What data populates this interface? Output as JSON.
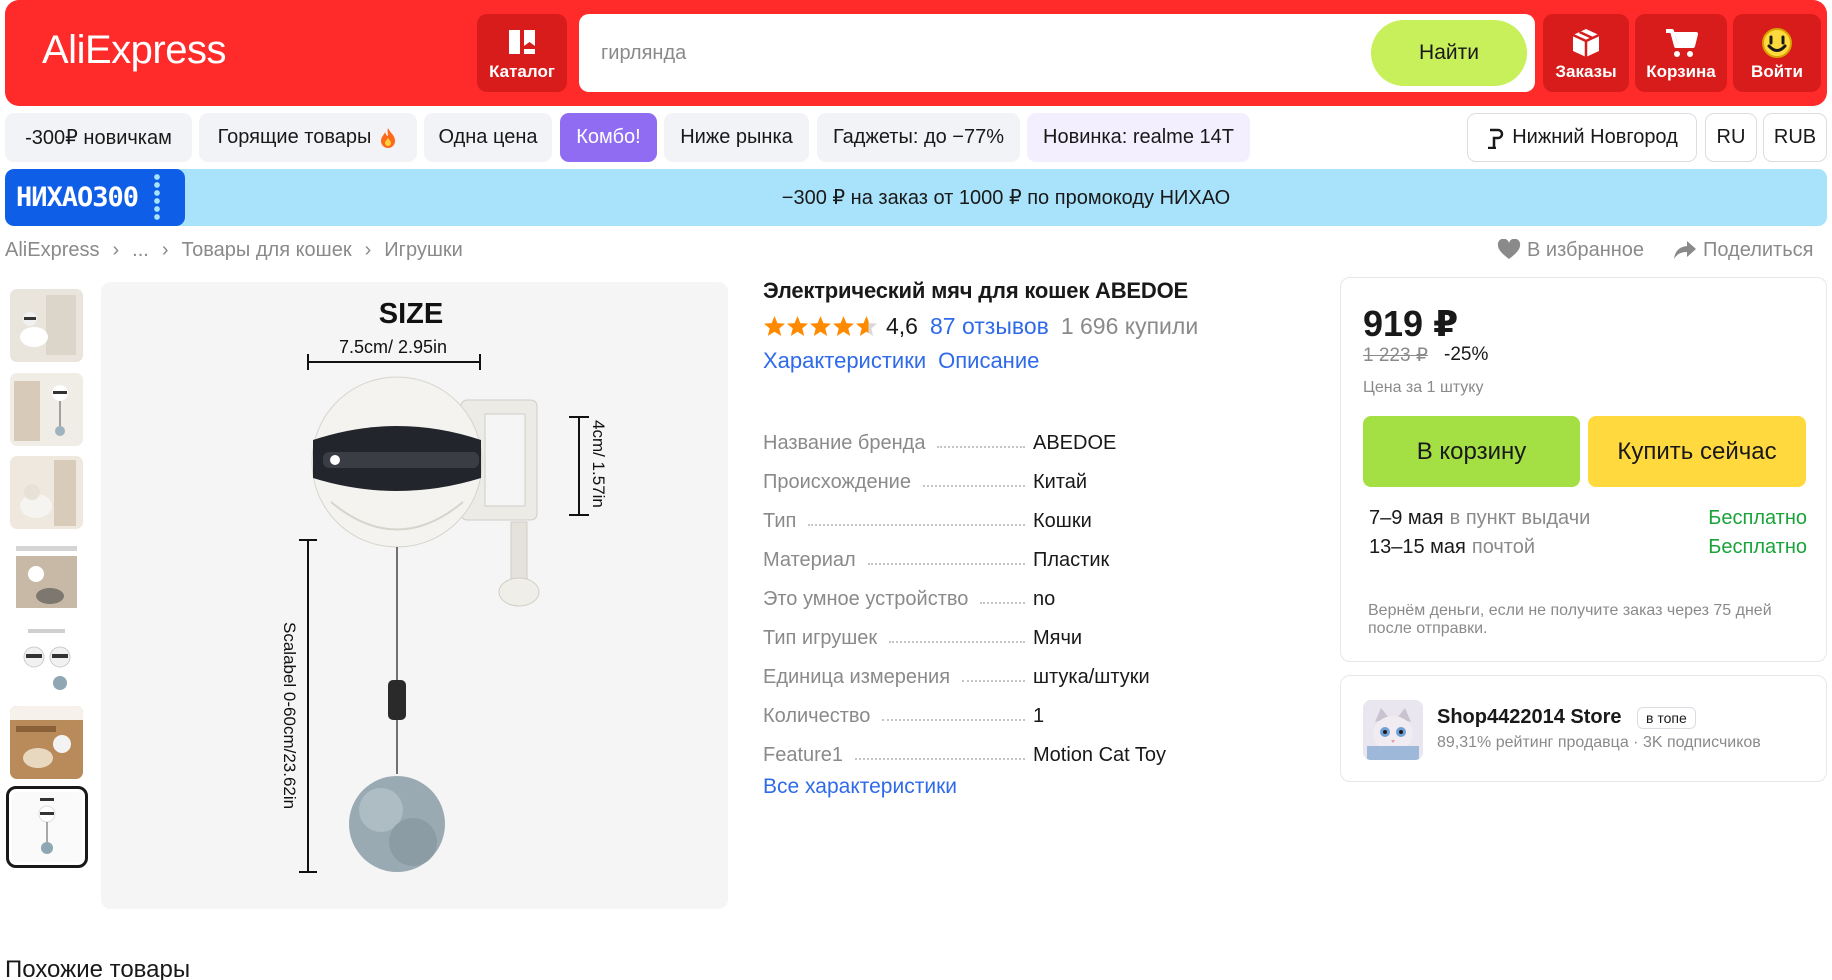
{
  "header": {
    "logo": "AliExpress",
    "catalog_label": "Каталог",
    "search_placeholder": "гирлянда",
    "search_button": "Найти",
    "orders_label": "Заказы",
    "cart_label": "Корзина",
    "login_label": "Войти"
  },
  "chips": {
    "items": [
      "-300₽ новичкам",
      "Горящие товары",
      "Одна цена",
      "Комбо!",
      "Ниже рынка",
      "Гаджеты: до −77%",
      "Новинка: realme 14T"
    ],
    "city": "Нижний Новгород",
    "lang": "RU",
    "currency": "RUB"
  },
  "promo": {
    "code": "НИХАО300",
    "text": "−300 ₽ на заказ от 1000 ₽ по промокоду НИХАО"
  },
  "breadcrumbs": [
    "AliExpress",
    "...",
    "Товары для кошек",
    "Игрушки"
  ],
  "actions": {
    "favorite": "В избранное",
    "share": "Поделиться"
  },
  "gallery": {
    "image_text": {
      "size": "SIZE",
      "width": "7.5cm/ 2.95in",
      "height": "4cm/ 1.57in",
      "length": "Scalabel 0-60cm/23.62in"
    }
  },
  "product": {
    "title": "Электрический мяч для кошек ABEDOE",
    "rating": "4,6",
    "rating_value": 4.6,
    "reviews": "87 отзывов",
    "bought": "1 696 купили",
    "tab_specs": "Характеристики",
    "tab_desc": "Описание",
    "specs": [
      {
        "k": "Название бренда",
        "v": "ABEDOE"
      },
      {
        "k": "Происхождение",
        "v": "Китай"
      },
      {
        "k": "Тип",
        "v": "Кошки"
      },
      {
        "k": "Материал",
        "v": "Пластик"
      },
      {
        "k": "Это умное устройство",
        "v": "no"
      },
      {
        "k": "Тип игрушек",
        "v": "Мячи"
      },
      {
        "k": "Единица измерения",
        "v": "штука/штуки"
      },
      {
        "k": "Количество",
        "v": "1"
      },
      {
        "k": "Feature1",
        "v": "Motion Cat Toy"
      }
    ],
    "all_specs": "Все характеристики"
  },
  "buy": {
    "price": "919 ₽",
    "old_price": "1 223 ₽",
    "discount": "-25%",
    "unit": "Цена за 1 штуку",
    "cart_button": "В корзину",
    "buy_button": "Купить сейчас",
    "delivery": [
      {
        "date": "7–9 мая",
        "where": "в пункт выдачи",
        "price": "Бесплатно"
      },
      {
        "date": "13–15 мая",
        "where": "почтой",
        "price": "Бесплатно"
      }
    ],
    "refund": "Вернём деньги, если не получите заказ через 75 дней после отправки."
  },
  "seller": {
    "name": "Shop4422014 Store",
    "badge": "в топе",
    "stats": "89,31% рейтинг продавца  ·  3K подписчиков"
  },
  "similar_title": "Похожие товары",
  "colors": {
    "header": "#ff2a2a",
    "accent_green": "#c7f05a",
    "cart_green": "#a4e044",
    "buy_yellow": "#ffd93d",
    "link": "#2f6ae8",
    "free": "#19a33a",
    "promo_bg": "#a9e3fb",
    "combo": "#8f6cf2"
  }
}
